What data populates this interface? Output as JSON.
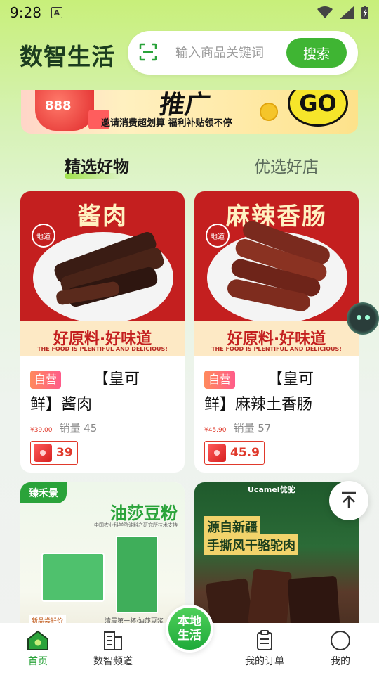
{
  "status_bar": {
    "time": "9:28",
    "notif": "A"
  },
  "header": {
    "logo": "数智生活",
    "search_placeholder": "输入商品关键词",
    "search_button": "搜索"
  },
  "banner": {
    "headline": "推广",
    "subtitle": "邀请消费超划算 福利补贴领不停",
    "coin": "888",
    "go": "GO"
  },
  "tabs": [
    {
      "label": "精选好物",
      "active": true
    },
    {
      "label": "优选好店",
      "active": false
    }
  ],
  "products": [
    {
      "image_title": "酱肉",
      "badge": "地道",
      "slogan": "好原料·好味道",
      "slogan_en": "THE FOOD IS PLENTIFUL AND DELICIOUS!",
      "tag": "自营",
      "name_a": "【皇可",
      "name_b": "鲜】酱肉",
      "price_small": "¥39.00",
      "sales": "销量 45",
      "coupon": "39"
    },
    {
      "image_title": "麻辣香肠",
      "badge": "地道",
      "slogan": "好原料·好味道",
      "slogan_en": "THE FOOD IS PLENTIFUL AND DELICIOUS!",
      "tag": "自营",
      "name_a": "【皇可",
      "name_b": "鲜】麻辣土香肠",
      "price_small": "¥45.90",
      "sales": "销量 57",
      "coupon": "45.9"
    },
    {
      "brand": "臻禾景",
      "title": "油莎豆粉",
      "subtitle": "中国农业科学院油料产研究所技术支持",
      "foot_l": "新品尝鲜价",
      "foot_r": "清晨第一杯·油莎豆浆"
    },
    {
      "brand": "Ucamel优驼",
      "title_1": "源自新疆",
      "title_2": "手撕风干骆驼肉"
    }
  ],
  "nav": {
    "home": "首页",
    "channel": "数智频道",
    "center": "本地生活",
    "order": "我的订单",
    "profile": "我的"
  },
  "colors": {
    "accent": "#3fb533",
    "price": "#e0392b",
    "product_red": "#c41f1f"
  }
}
